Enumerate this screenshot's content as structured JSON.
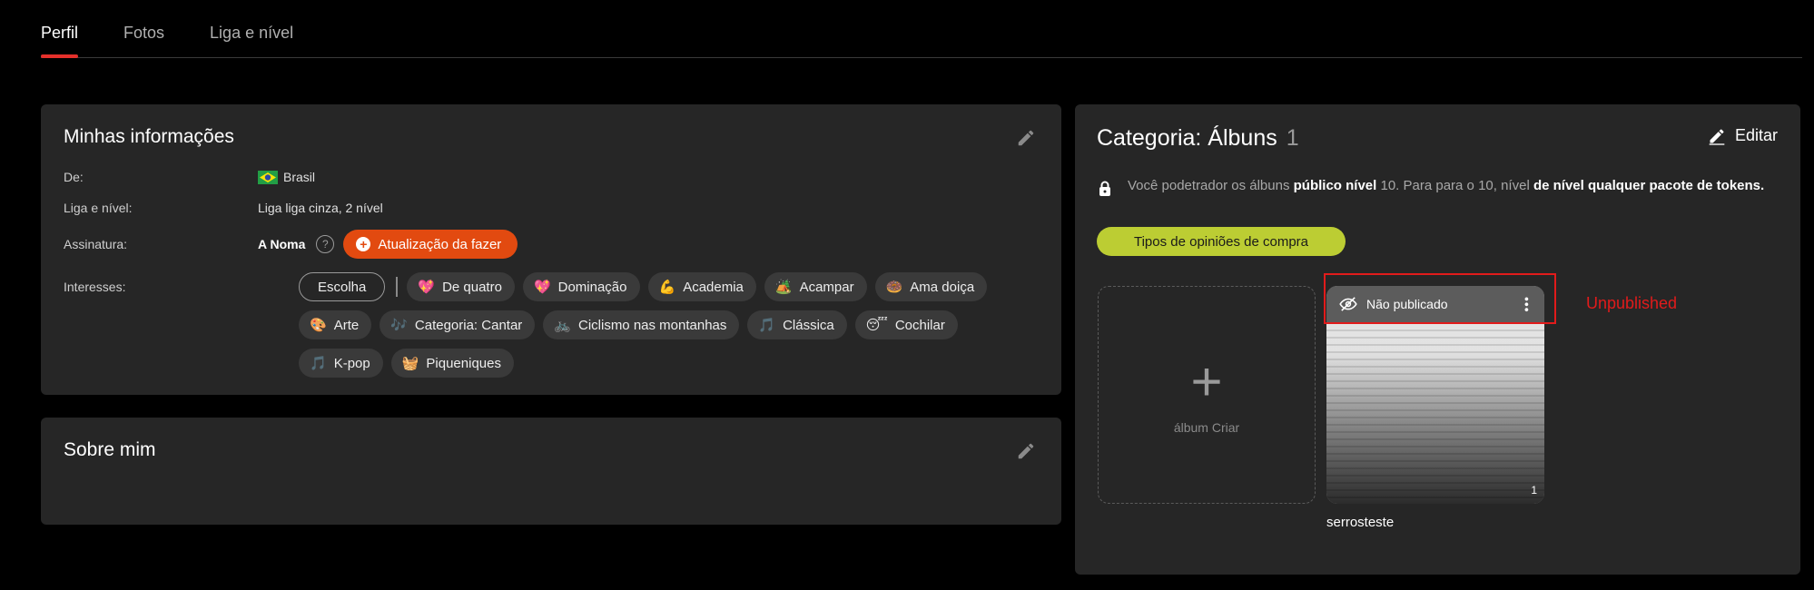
{
  "tabs": [
    {
      "label": "Perfil",
      "active": true
    },
    {
      "label": "Fotos",
      "active": false
    },
    {
      "label": "Liga e nível",
      "active": false
    }
  ],
  "info": {
    "title": "Minhas informações",
    "rows": {
      "from": {
        "label": "De:",
        "value": "Brasil"
      },
      "league": {
        "label": "Liga e nível:",
        "value": "Liga liga cinza, 2 nível"
      },
      "subscription": {
        "label": "Assinatura:",
        "value": "A Noma",
        "help": "?",
        "upgrade": "Atualização da fazer"
      },
      "interests": {
        "label": "Interesses:"
      }
    },
    "choose_label": "Escolha",
    "interests": [
      {
        "emoji": "💖",
        "label": "De quatro"
      },
      {
        "emoji": "💖",
        "label": "Dominação"
      },
      {
        "emoji": "💪",
        "label": "Academia"
      },
      {
        "emoji": "🏕️",
        "label": "Acampar"
      },
      {
        "emoji": "🍩",
        "label": "Ama doiça"
      },
      {
        "emoji": "🎨",
        "label": "Arte"
      },
      {
        "emoji": "🎶",
        "label": "Categoria: Cantar"
      },
      {
        "emoji": "🚲",
        "label": "Ciclismo nas montanhas"
      },
      {
        "emoji": "🎵",
        "label": "Clássica"
      },
      {
        "emoji": "😴",
        "label": "Cochilar"
      },
      {
        "emoji": "🎵",
        "label": "K-pop"
      },
      {
        "emoji": "🧺",
        "label": "Piqueniques"
      }
    ]
  },
  "about": {
    "title": "Sobre mim"
  },
  "albums": {
    "title": "Categoria: Álbuns",
    "count": "1",
    "edit_label": "Editar",
    "notice": {
      "p1": "Você podetrador os álbuns ",
      "b1": "público nível",
      "p2": " 10. Para para o 10, nível ",
      "b2": "de nível qualquer pacote de tokens."
    },
    "buy_label": "Tipos de opiniões de compra",
    "create_label": "álbum Criar",
    "create_plus": "+",
    "album": {
      "status": "Não publicado",
      "count": "1",
      "name": "serrosteste",
      "more": "•••"
    }
  },
  "annotation": "Unpublished",
  "colors": {
    "accent_red": "#e5302b",
    "upgrade": "#e24a10",
    "lime": "#bccd33",
    "card": "#262626"
  }
}
